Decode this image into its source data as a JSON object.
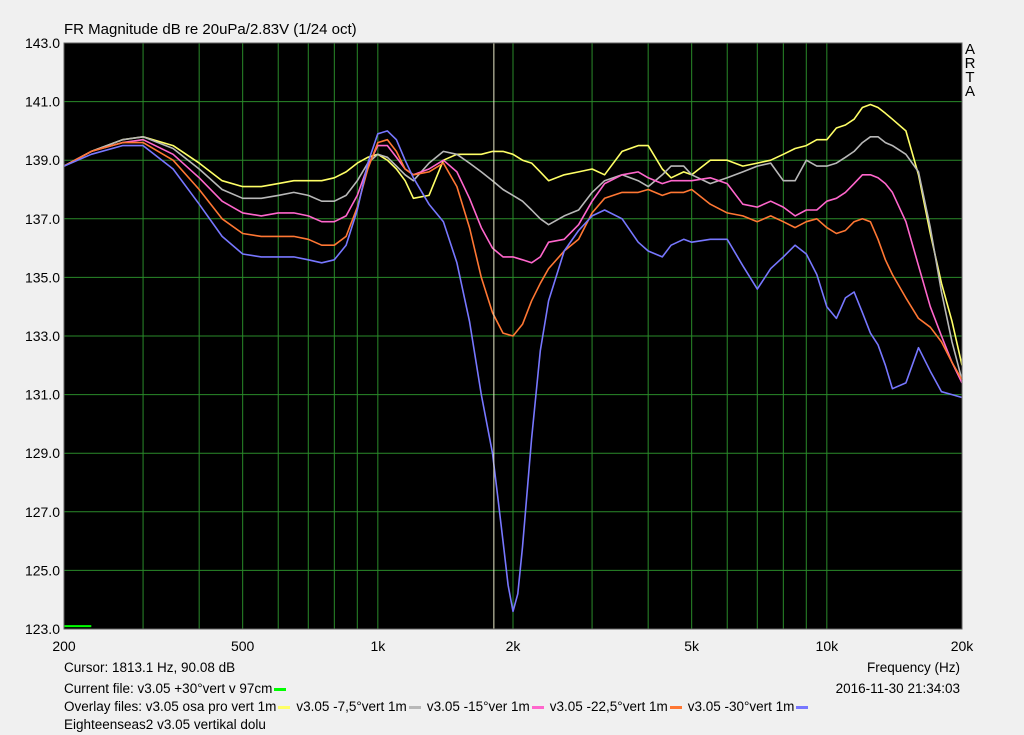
{
  "title": "FR Magnitude dB re 20uPa/2.83V (1/24 oct)",
  "brand_letters": [
    "A",
    "R",
    "T",
    "A"
  ],
  "footer": {
    "cursor": "Cursor:  1813.1 Hz, 90.08 dB",
    "frequency_label": "Frequency (Hz)",
    "current_prefix": "Current file: v3.05 +30°vert v 97cm",
    "timestamp": "2016-11-30   21:34:03",
    "overlay_prefix": "Overlay files: ",
    "comment": "Eighteenseas2 v3.05 vertikal dolu"
  },
  "chart_data": {
    "type": "line",
    "title": "FR Magnitude dB re 20uPa/2.83V (1/24 oct)",
    "xlabel": "Frequency (Hz)",
    "ylabel": "",
    "x_scale": "log",
    "xlim": [
      200,
      20000
    ],
    "ylim": [
      123,
      143
    ],
    "x_ticks": [
      200,
      500,
      1000,
      2000,
      5000,
      10000,
      20000
    ],
    "x_tick_labels": [
      "200",
      "500",
      "1k",
      "2k",
      "5k",
      "10k",
      "20k"
    ],
    "x_minor_ticks": [
      300,
      400,
      600,
      700,
      800,
      900,
      3000,
      4000,
      6000,
      7000,
      8000,
      9000
    ],
    "y_ticks": [
      123,
      125,
      127,
      129,
      131,
      133,
      135,
      137,
      139,
      141,
      143
    ],
    "y_tick_labels": [
      "123.0",
      "125.0",
      "127.0",
      "129.0",
      "131.0",
      "133.0",
      "135.0",
      "137.0",
      "139.0",
      "141.0",
      "143.0"
    ],
    "cursor_x": 1813.1,
    "grid": true,
    "colors": {
      "background": "#000000",
      "grid": "#2a8a2a",
      "cursor": "#e8e8c8"
    },
    "current_file": {
      "name": "v3.05 +30°vert v 97cm",
      "color": "#00ff00",
      "x": [
        200,
        230
      ],
      "y": [
        123.1,
        123.1
      ]
    },
    "series": [
      {
        "name": "v3.05 osa pro vert 1m",
        "color": "#ffff66",
        "x": [
          200,
          230,
          270,
          300,
          350,
          400,
          450,
          500,
          550,
          600,
          650,
          700,
          750,
          800,
          850,
          900,
          950,
          1000,
          1050,
          1100,
          1150,
          1200,
          1300,
          1400,
          1500,
          1600,
          1700,
          1800,
          1900,
          2000,
          2100,
          2200,
          2300,
          2400,
          2600,
          2800,
          3000,
          3200,
          3500,
          3800,
          4000,
          4300,
          4500,
          4800,
          5000,
          5500,
          6000,
          6500,
          7000,
          7500,
          8000,
          8500,
          9000,
          9500,
          10000,
          10500,
          11000,
          11500,
          12000,
          12500,
          13000,
          13500,
          14000,
          15000,
          16000,
          17000,
          18000,
          19000,
          20000
        ],
        "y": [
          138.8,
          139.3,
          139.7,
          139.8,
          139.5,
          138.9,
          138.3,
          138.1,
          138.1,
          138.2,
          138.3,
          138.3,
          138.3,
          138.4,
          138.6,
          138.9,
          139.1,
          139.2,
          139.0,
          138.7,
          138.3,
          137.7,
          137.8,
          139.0,
          139.2,
          139.2,
          139.2,
          139.3,
          139.3,
          139.2,
          139.0,
          138.9,
          138.6,
          138.3,
          138.5,
          138.6,
          138.7,
          138.5,
          139.3,
          139.5,
          139.5,
          138.7,
          138.4,
          138.6,
          138.5,
          139.0,
          139.0,
          138.8,
          138.9,
          139.0,
          139.2,
          139.4,
          139.5,
          139.7,
          139.7,
          140.1,
          140.2,
          140.4,
          140.8,
          140.9,
          140.8,
          140.6,
          140.4,
          140.0,
          138.5,
          136.5,
          134.8,
          133.5,
          132.0
        ]
      },
      {
        "name": "v3.05 -7,5°vert 1m",
        "color": "#b8b8b8",
        "x": [
          200,
          230,
          270,
          300,
          350,
          400,
          450,
          500,
          550,
          600,
          650,
          700,
          750,
          800,
          850,
          900,
          950,
          1000,
          1050,
          1100,
          1150,
          1200,
          1300,
          1400,
          1500,
          1600,
          1700,
          1800,
          1900,
          2000,
          2100,
          2200,
          2300,
          2400,
          2600,
          2800,
          3000,
          3200,
          3500,
          3800,
          4000,
          4300,
          4500,
          4800,
          5000,
          5500,
          6000,
          6500,
          7000,
          7500,
          8000,
          8500,
          9000,
          9500,
          10000,
          10500,
          11000,
          11500,
          12000,
          12500,
          13000,
          13500,
          14000,
          15000,
          16000,
          17000,
          18000,
          19000,
          20000
        ],
        "y": [
          138.8,
          139.3,
          139.7,
          139.8,
          139.4,
          138.7,
          138.0,
          137.7,
          137.7,
          137.8,
          137.9,
          137.8,
          137.6,
          137.6,
          137.8,
          138.3,
          138.9,
          139.2,
          139.1,
          138.8,
          138.5,
          138.3,
          138.9,
          139.3,
          139.2,
          138.9,
          138.6,
          138.3,
          138.0,
          137.8,
          137.6,
          137.3,
          137.0,
          136.8,
          137.1,
          137.3,
          137.9,
          138.3,
          138.5,
          138.3,
          138.1,
          138.5,
          138.8,
          138.8,
          138.5,
          138.2,
          138.4,
          138.6,
          138.8,
          138.9,
          138.3,
          138.3,
          139.0,
          138.8,
          138.8,
          138.9,
          139.1,
          139.3,
          139.6,
          139.8,
          139.8,
          139.6,
          139.5,
          139.2,
          138.6,
          136.7,
          134.5,
          132.8,
          131.5
        ]
      },
      {
        "name": "v3.05 -15°ver 1m",
        "color": "#ff66cc",
        "x": [
          200,
          230,
          270,
          300,
          350,
          400,
          450,
          500,
          550,
          600,
          650,
          700,
          750,
          800,
          850,
          900,
          950,
          1000,
          1050,
          1100,
          1150,
          1200,
          1300,
          1400,
          1500,
          1600,
          1700,
          1800,
          1900,
          2000,
          2100,
          2200,
          2300,
          2400,
          2600,
          2800,
          3000,
          3200,
          3500,
          3800,
          4000,
          4300,
          4500,
          4800,
          5000,
          5500,
          6000,
          6500,
          7000,
          7500,
          8000,
          8500,
          9000,
          9500,
          10000,
          10500,
          11000,
          11500,
          12000,
          12500,
          13000,
          13500,
          14000,
          15000,
          16000,
          17000,
          18000,
          19000,
          20000
        ],
        "y": [
          138.8,
          139.3,
          139.6,
          139.7,
          139.2,
          138.4,
          137.6,
          137.2,
          137.1,
          137.2,
          137.2,
          137.1,
          136.9,
          136.9,
          137.1,
          137.8,
          138.8,
          139.5,
          139.5,
          139.1,
          138.7,
          138.5,
          138.7,
          139.0,
          138.6,
          137.7,
          136.7,
          136.0,
          135.7,
          135.7,
          135.6,
          135.5,
          135.7,
          136.2,
          136.3,
          136.8,
          137.6,
          138.2,
          138.5,
          138.6,
          138.4,
          138.2,
          138.3,
          138.3,
          138.3,
          138.4,
          138.2,
          137.5,
          137.4,
          137.6,
          137.4,
          137.1,
          137.3,
          137.3,
          137.6,
          137.7,
          137.9,
          138.2,
          138.5,
          138.5,
          138.4,
          138.2,
          137.9,
          136.9,
          135.4,
          134.0,
          133.0,
          132.1,
          131.4
        ]
      },
      {
        "name": "v3.05 -22,5°vert 1m",
        "color": "#ff7733",
        "x": [
          200,
          230,
          270,
          300,
          350,
          400,
          450,
          500,
          550,
          600,
          650,
          700,
          750,
          800,
          850,
          900,
          950,
          1000,
          1050,
          1100,
          1150,
          1200,
          1300,
          1400,
          1500,
          1600,
          1700,
          1800,
          1900,
          2000,
          2100,
          2200,
          2300,
          2400,
          2600,
          2800,
          3000,
          3200,
          3500,
          3800,
          4000,
          4300,
          4500,
          4800,
          5000,
          5500,
          6000,
          6500,
          7000,
          7500,
          8000,
          8500,
          9000,
          9500,
          10000,
          10500,
          11000,
          11500,
          12000,
          12500,
          13000,
          13500,
          14000,
          15000,
          16000,
          17000,
          18000,
          19000,
          20000
        ],
        "y": [
          138.8,
          139.3,
          139.6,
          139.6,
          139.0,
          138.0,
          137.0,
          136.5,
          136.4,
          136.4,
          136.4,
          136.3,
          136.1,
          136.1,
          136.4,
          137.4,
          138.7,
          139.6,
          139.7,
          139.3,
          138.7,
          138.5,
          138.6,
          138.9,
          138.1,
          136.7,
          135.0,
          133.8,
          133.1,
          133.0,
          133.4,
          134.2,
          134.8,
          135.3,
          135.9,
          136.3,
          137.2,
          137.7,
          137.9,
          137.9,
          138.0,
          137.8,
          137.9,
          137.9,
          138.0,
          137.5,
          137.2,
          137.1,
          136.9,
          137.1,
          136.9,
          136.7,
          136.9,
          137.0,
          136.7,
          136.5,
          136.6,
          136.9,
          137.0,
          136.9,
          136.3,
          135.6,
          135.1,
          134.3,
          133.6,
          133.3,
          132.8,
          132.1,
          131.5
        ]
      },
      {
        "name": "v3.05 -30°vert 1m",
        "color": "#7777ff",
        "x": [
          200,
          230,
          270,
          300,
          350,
          400,
          450,
          500,
          550,
          600,
          650,
          700,
          750,
          800,
          850,
          900,
          950,
          1000,
          1050,
          1100,
          1150,
          1200,
          1300,
          1400,
          1500,
          1600,
          1700,
          1800,
          1850,
          1900,
          1950,
          2000,
          2050,
          2100,
          2200,
          2300,
          2400,
          2600,
          2800,
          3000,
          3200,
          3500,
          3800,
          4000,
          4300,
          4500,
          4800,
          5000,
          5500,
          6000,
          6500,
          7000,
          7500,
          8000,
          8500,
          9000,
          9500,
          10000,
          10500,
          11000,
          11500,
          12000,
          12500,
          13000,
          13500,
          14000,
          15000,
          16000,
          17000,
          18000,
          19000,
          20000
        ],
        "y": [
          138.8,
          139.2,
          139.5,
          139.5,
          138.7,
          137.5,
          136.4,
          135.8,
          135.7,
          135.7,
          135.7,
          135.6,
          135.5,
          135.6,
          136.1,
          137.3,
          138.9,
          139.9,
          140.0,
          139.7,
          139.0,
          138.4,
          137.5,
          136.9,
          135.5,
          133.5,
          131.0,
          129.0,
          127.5,
          126.0,
          124.5,
          123.6,
          124.2,
          125.8,
          129.5,
          132.5,
          134.2,
          135.9,
          136.6,
          137.1,
          137.3,
          137.0,
          136.2,
          135.9,
          135.7,
          136.1,
          136.3,
          136.2,
          136.3,
          136.3,
          135.4,
          134.6,
          135.3,
          135.7,
          136.1,
          135.8,
          135.1,
          134.0,
          133.6,
          134.3,
          134.5,
          133.8,
          133.1,
          132.7,
          132.0,
          131.2,
          131.4,
          132.6,
          131.8,
          131.1,
          131.0,
          130.9
        ]
      }
    ]
  }
}
